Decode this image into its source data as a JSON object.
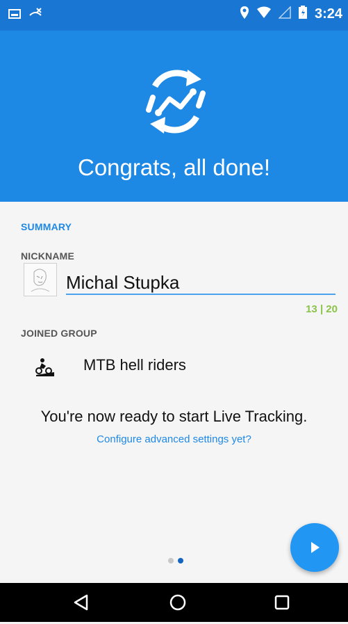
{
  "status_bar": {
    "time": "3:24",
    "icons": [
      "image-notification-icon",
      "missed-call-icon",
      "location-icon",
      "wifi-icon",
      "signal-icon",
      "battery-icon"
    ]
  },
  "header": {
    "logo_icon": "live-tracking-sync-icon",
    "title": "Congrats, all done!",
    "color": "#1e88e5"
  },
  "summary": {
    "section_label": "SUMMARY",
    "nickname_label": "NICKNAME",
    "nickname_value": "Michal Stupka",
    "char_counter": "13 | 20",
    "joined_group_label": "JOINED GROUP",
    "group_name": "MTB hell riders",
    "group_icon": "mountain-bike-icon"
  },
  "message": {
    "ready_text": "You're now ready to start Live Tracking.",
    "configure_link": "Configure advanced settings yet?"
  },
  "pager": {
    "pages": 2,
    "current": 2
  },
  "fab": {
    "icon": "play-arrow-icon"
  },
  "nav_bar": {
    "icons": [
      "back-icon",
      "home-icon",
      "recents-icon"
    ]
  }
}
